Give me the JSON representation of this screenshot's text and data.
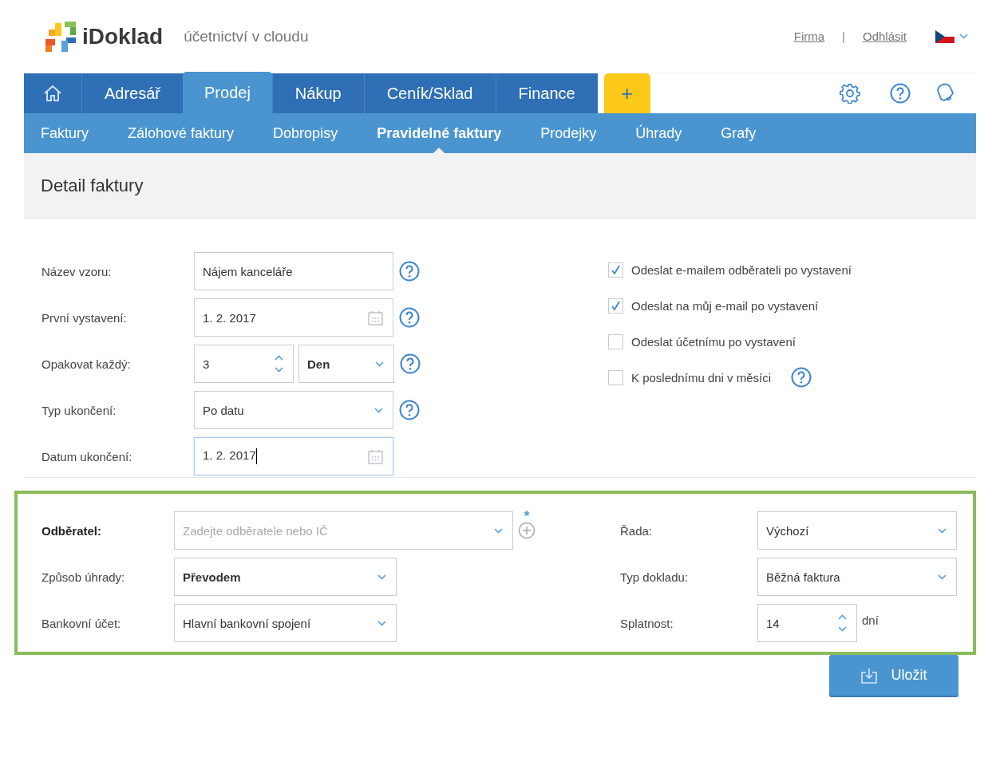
{
  "header": {
    "brand": "iDoklad",
    "tagline": "účetnictví v cloudu",
    "links": [
      "Firma",
      "Odhlásit"
    ],
    "separator": "|"
  },
  "main_nav": [
    {
      "label": "Adresář",
      "selected": false
    },
    {
      "label": "Prodej",
      "selected": true
    },
    {
      "label": "Nákup",
      "selected": false
    },
    {
      "label": "Ceník/Sklad",
      "selected": false
    },
    {
      "label": "Finance",
      "selected": false
    }
  ],
  "add_button": "+",
  "sub_nav": [
    {
      "label": "Faktury",
      "selected": false
    },
    {
      "label": "Zálohové faktury",
      "selected": false
    },
    {
      "label": "Dobropisy",
      "selected": false
    },
    {
      "label": "Pravidelné faktury",
      "selected": true
    },
    {
      "label": "Prodejky",
      "selected": false
    },
    {
      "label": "Úhrady",
      "selected": false
    },
    {
      "label": "Grafy",
      "selected": false
    }
  ],
  "page_title": "Detail faktury",
  "template_fields": [
    {
      "kind": "text",
      "label": "Název vzoru:",
      "value": "Nájem kanceláře",
      "help": true,
      "focused": false
    },
    {
      "kind": "date",
      "label": "První vystavení:",
      "value": "1. 2. 2017",
      "help": true,
      "focused": false
    },
    {
      "kind": "repeat",
      "label": "Opakovat každý:",
      "value": "3",
      "unit": "Den",
      "help": true,
      "focused": false
    },
    {
      "kind": "select",
      "label": "Typ ukončení:",
      "value": "Po datu",
      "help": true,
      "focused": false
    },
    {
      "kind": "date",
      "label": "Datum ukončení:",
      "value": "1. 2. 2017",
      "help": false,
      "focused": true
    }
  ],
  "options": [
    {
      "label": "Odeslat e-mailem odběrateli po vystavení",
      "checked": true,
      "help": false
    },
    {
      "label": "Odeslat na můj e-mail po vystavení",
      "checked": true,
      "help": false
    },
    {
      "label": "Odeslat účetnímu po vystavení",
      "checked": false,
      "help": false
    },
    {
      "label": "K poslednímu dni v měsíci",
      "checked": false,
      "help": true
    }
  ],
  "document_left": [
    {
      "kind": "combo",
      "label": "Odběratel:",
      "required": true,
      "marker": "*",
      "placeholder": "Zadejte odběratele nebo IČ",
      "bold": false
    },
    {
      "kind": "select",
      "label": "Způsob úhrady:",
      "required": false,
      "value": "Převodem",
      "bold": true
    },
    {
      "kind": "select",
      "label": "Bankovní účet:",
      "required": false,
      "value": "Hlavní bankovní spojení",
      "bold": false
    }
  ],
  "document_right": [
    {
      "kind": "select",
      "label": "Řada:",
      "value": "Výchozí"
    },
    {
      "kind": "select",
      "label": "Typ dokladu:",
      "value": "Běžná faktura"
    },
    {
      "kind": "number",
      "label": "Splatnost:",
      "value": "14",
      "suffix": "dní"
    }
  ],
  "save_button": "Uložit"
}
